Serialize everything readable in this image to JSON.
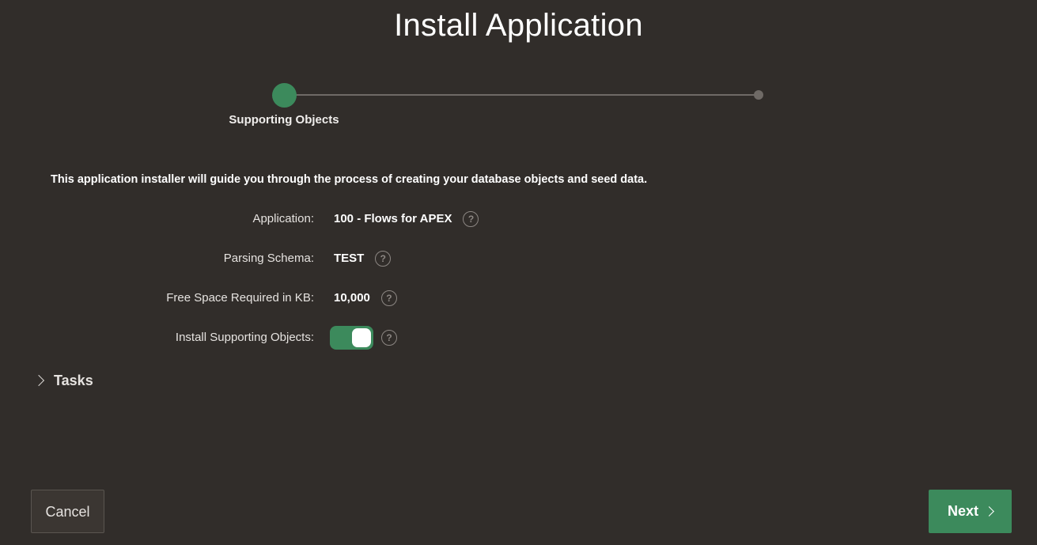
{
  "page": {
    "title": "Install Application"
  },
  "wizard": {
    "current_step_label": "Supporting Objects",
    "steps_total": 2,
    "current_step": 1
  },
  "intro": {
    "text": "This application installer will guide you through the process of creating your database objects and seed data."
  },
  "form": {
    "application": {
      "label": "Application:",
      "value": "100 - Flows for APEX"
    },
    "parsing_schema": {
      "label": "Parsing Schema:",
      "value": "TEST"
    },
    "free_space": {
      "label": "Free Space Required in KB:",
      "value": "10,000"
    },
    "install_supporting_objects": {
      "label": "Install Supporting Objects:",
      "enabled": true
    },
    "help_glyph": "?"
  },
  "tasks": {
    "label": "Tasks",
    "expanded": false
  },
  "buttons": {
    "cancel_label": "Cancel",
    "next_label": "Next"
  },
  "colors": {
    "background": "#312d2a",
    "accent": "#3c8a5c",
    "progress_track": "#6f6a66"
  },
  "icons": {
    "help": "help-circle-icon",
    "tasks_chevron": "chevron-right-icon",
    "next_chevron": "chevron-right-icon"
  }
}
